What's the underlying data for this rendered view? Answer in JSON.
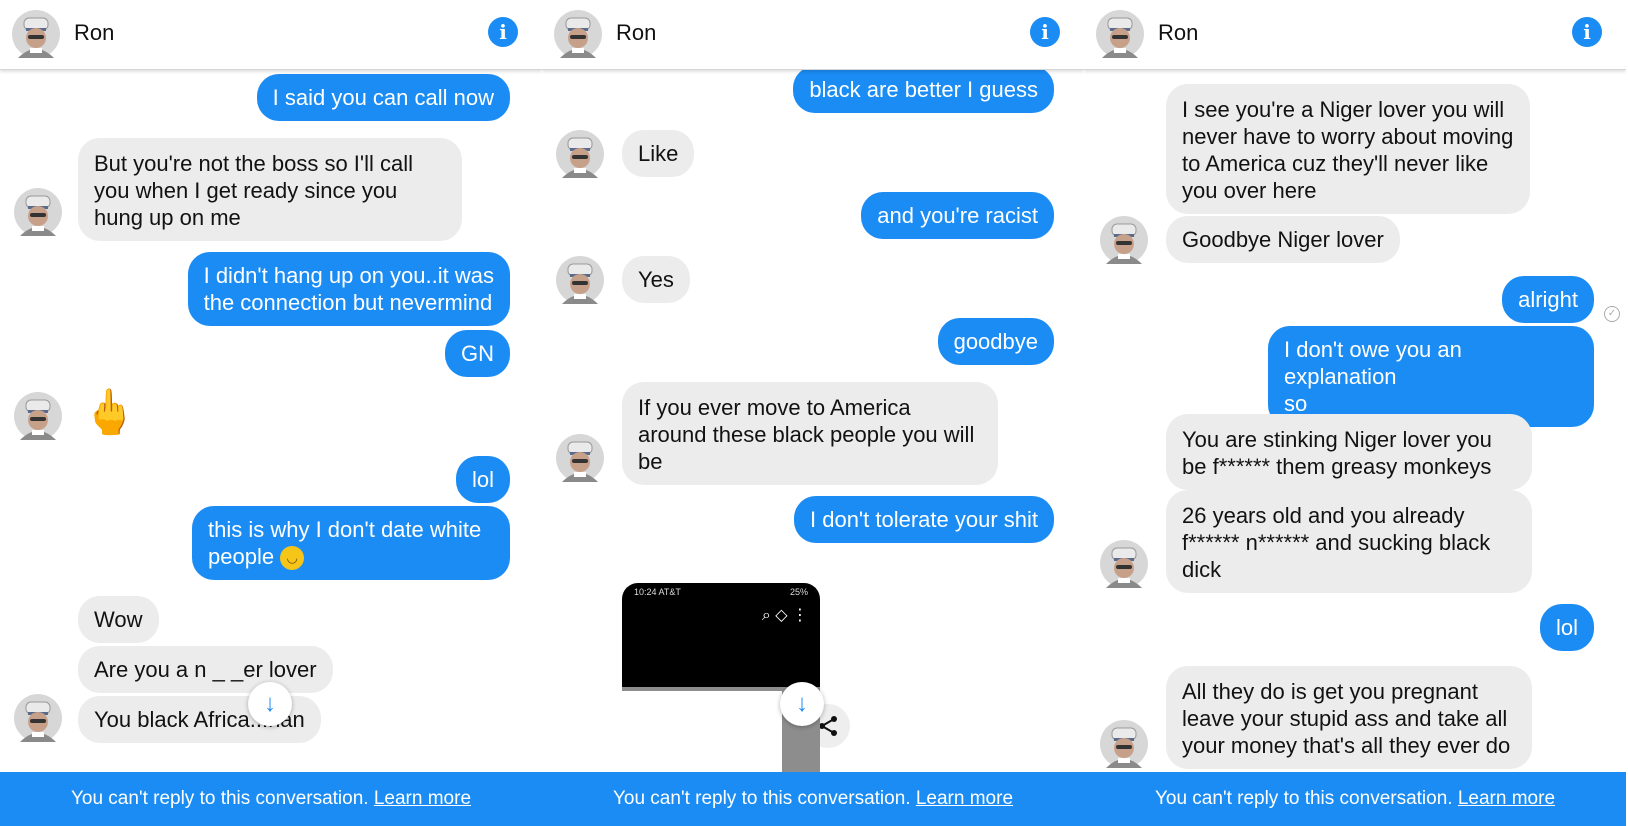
{
  "contact": {
    "name": "Ron"
  },
  "panel1": {
    "messages": [
      {
        "dir": "out",
        "text": "I said you can call now"
      },
      {
        "dir": "in",
        "lines": [
          "But you're not the boss so I'll call",
          "you when I get ready since you",
          "hung up on me"
        ]
      },
      {
        "dir": "out",
        "lines": [
          "I didn't hang up on you..it was",
          "the connection but nevermind"
        ]
      },
      {
        "dir": "out",
        "text": "GN"
      },
      {
        "dir": "in",
        "emoji": "🖕"
      },
      {
        "dir": "out",
        "text": "lol"
      },
      {
        "dir": "out",
        "lines": [
          "this is why I don't date white",
          "people"
        ],
        "emoji": "😏"
      },
      {
        "dir": "in",
        "text": "Wow"
      },
      {
        "dir": "in",
        "text": "Are you a n _ _er lover"
      },
      {
        "dir": "in",
        "text": "You black Africa...nan"
      }
    ]
  },
  "panel2": {
    "messages": [
      {
        "dir": "out",
        "text": "black are better I guess"
      },
      {
        "dir": "in",
        "text": "Like"
      },
      {
        "dir": "out",
        "text": "and you're racist"
      },
      {
        "dir": "in",
        "text": "Yes"
      },
      {
        "dir": "out",
        "text": "goodbye"
      },
      {
        "dir": "in",
        "lines": [
          "If you ever move to America",
          "around these black people you will",
          "be"
        ]
      },
      {
        "dir": "out",
        "text": "I don't tolerate your shit"
      }
    ],
    "screenshot": {
      "time": "10:24 AT&T",
      "status": "25%"
    }
  },
  "panel3": {
    "messages": [
      {
        "dir": "in",
        "lines": [
          "I see you're a Niger lover you will",
          "never have to worry about moving",
          "to America cuz they'll never like",
          "you over here"
        ]
      },
      {
        "dir": "in",
        "text": "Goodbye Niger lover"
      },
      {
        "dir": "out",
        "text": "alright"
      },
      {
        "dir": "out",
        "lines": [
          "I don't owe you an explanation",
          "so"
        ]
      },
      {
        "dir": "in",
        "lines": [
          "You are stinking Niger lover you",
          "be f****** them greasy monkeys"
        ]
      },
      {
        "dir": "in",
        "lines": [
          "26 years old and you already",
          "f****** n****** and sucking black",
          "dick"
        ]
      },
      {
        "dir": "out",
        "text": "lol"
      },
      {
        "dir": "in",
        "lines": [
          "All they do is get you pregnant",
          "leave your stupid ass and take all",
          "your money that's all they ever do"
        ]
      }
    ]
  },
  "footer": {
    "text": "You can't reply to this conversation.",
    "link": "Learn more"
  },
  "icons": {
    "info": "info-icon",
    "scroll": "arrow-down-icon",
    "share": "share-icon",
    "seen": "check-circle-icon"
  },
  "colors": {
    "accent": "#1a8cf4",
    "incoming_bubble": "#ececec",
    "footer": "#1a8cf4"
  }
}
